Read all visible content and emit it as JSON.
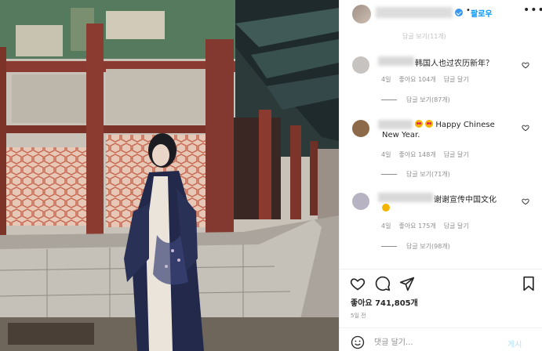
{
  "header": {
    "username": "",
    "follow_label": "팔로우",
    "dot": "•",
    "more_label": "•••"
  },
  "top_partial": "답글 보기(11개)",
  "comments": [
    {
      "text": "韩国人也过农历新年？",
      "time": "4일",
      "likes": "좋아요 104개",
      "reply": "답글 달기",
      "view_replies": "답글 보기(87개)"
    },
    {
      "text_line1": "Happy Chinese",
      "text_line2": "New Year.",
      "time": "4일",
      "likes": "좋아요 148개",
      "reply": "답글 달기",
      "view_replies": "답글 보기(71개)"
    },
    {
      "text": "谢谢宣传中国文化",
      "time": "4일",
      "likes": "좋아요 175개",
      "reply": "답글 달기",
      "view_replies": "답글 보기(98개)"
    }
  ],
  "post": {
    "likes_label": "좋아요 741,805개",
    "ago": "5일 전"
  },
  "comment_box": {
    "placeholder": "댓글 달기...",
    "post_label": "게시"
  },
  "icons": {
    "like": "heart-icon",
    "comment": "comment-icon",
    "share": "send-icon",
    "save": "bookmark-icon",
    "emoji": "smiley-icon"
  },
  "colors": {
    "accent": "#0095f6",
    "muted": "#8e8e8e",
    "text": "#262626"
  }
}
